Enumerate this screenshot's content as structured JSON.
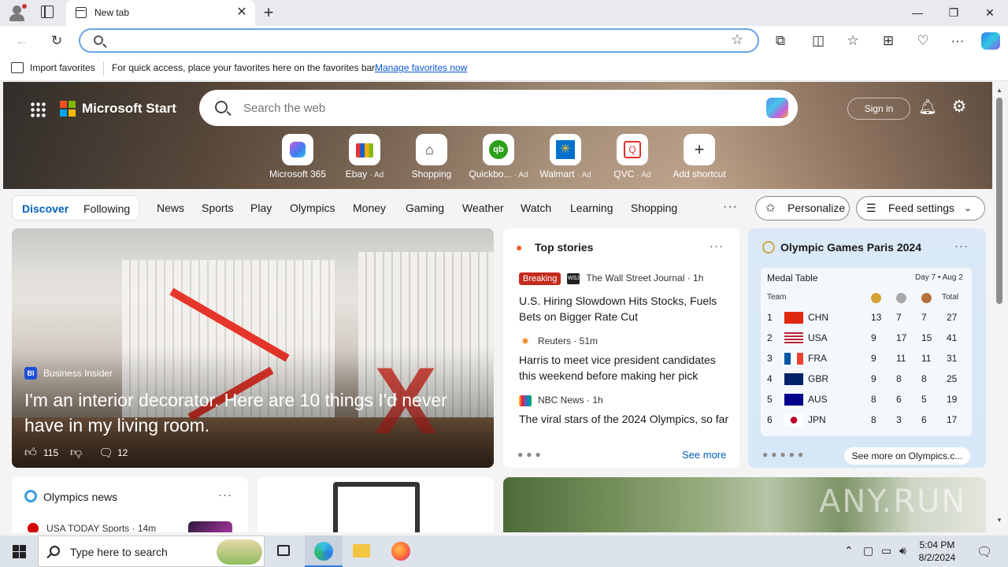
{
  "browser": {
    "tab_title": "New tab",
    "tab_close": "✕",
    "new_tab": "+",
    "address_placeholder": "",
    "window_controls": {
      "minimize": "—",
      "maximize": "❐",
      "close": "✕"
    },
    "toolbar_icons": [
      "back-icon",
      "refresh-icon",
      "star-icon",
      "extensions-icon",
      "split-screen-icon",
      "favorites-icon",
      "collections-icon",
      "performance-icon",
      "more-icon",
      "copilot-icon"
    ]
  },
  "favorites_bar": {
    "import_label": "Import favorites",
    "message": "For quick access, place your favorites here on the favorites bar.",
    "manage_link": "Manage favorites now"
  },
  "start_page": {
    "brand": "Microsoft Start",
    "search_placeholder": "Search the web",
    "sign_in": "Sign in",
    "shortcuts": [
      {
        "label": "Microsoft 365",
        "ad": "",
        "icon": "microsoft-365-icon"
      },
      {
        "label": "Ebay",
        "ad": "· Ad",
        "icon": "ebay-icon"
      },
      {
        "label": "Shopping",
        "ad": "",
        "icon": "shopping-tag-icon"
      },
      {
        "label": "Quickbo...",
        "ad": "· Ad",
        "icon": "quickbooks-icon"
      },
      {
        "label": "Walmart",
        "ad": "· Ad",
        "icon": "walmart-icon"
      },
      {
        "label": "QVC",
        "ad": "· Ad",
        "icon": "qvc-icon"
      },
      {
        "label": "Add shortcut",
        "ad": "",
        "icon": "plus-icon"
      }
    ],
    "nav": {
      "discover": "Discover",
      "following": "Following",
      "items": [
        "News",
        "Sports",
        "Play",
        "Olympics",
        "Money",
        "Gaming",
        "Weather",
        "Watch",
        "Learning",
        "Shopping"
      ],
      "more": "···",
      "personalize": "Personalize",
      "feed_settings": "Feed settings"
    },
    "hero": {
      "source": "Business Insider",
      "source_badge": "BI",
      "headline": "I'm an interior decorator. Here are 10 things I'd never have in my living room.",
      "likes": "115",
      "comments": "12"
    },
    "top_stories": {
      "title": "Top stories",
      "stories": [
        {
          "badge": "Breaking",
          "source": "The Wall Street Journal · 1h",
          "logo": "WSJ",
          "headline": "U.S. Hiring Slowdown Hits Stocks, Fuels Bets on Bigger Rate Cut"
        },
        {
          "badge": "",
          "source": "Reuters · 51m",
          "logo": "",
          "headline": "Harris to meet vice president candidates this weekend before making her pick"
        },
        {
          "badge": "",
          "source": "NBC News · 1h",
          "logo": "",
          "headline": "The viral stars of the 2024 Olympics, so far"
        }
      ],
      "see_more": "See more"
    },
    "olympics": {
      "title": "Olympic Games Paris 2024",
      "table_title": "Medal Table",
      "day": "Day 7 • Aug 2",
      "col_team": "Team",
      "col_total": "Total",
      "rows": [
        {
          "rank": "1",
          "team": "CHN",
          "gold": "13",
          "silver": "7",
          "bronze": "7",
          "total": "27"
        },
        {
          "rank": "2",
          "team": "USA",
          "gold": "9",
          "silver": "17",
          "bronze": "15",
          "total": "41"
        },
        {
          "rank": "3",
          "team": "FRA",
          "gold": "9",
          "silver": "11",
          "bronze": "11",
          "total": "31"
        },
        {
          "rank": "4",
          "team": "GBR",
          "gold": "9",
          "silver": "8",
          "bronze": "8",
          "total": "25"
        },
        {
          "rank": "5",
          "team": "AUS",
          "gold": "8",
          "silver": "6",
          "bronze": "5",
          "total": "19"
        },
        {
          "rank": "6",
          "team": "JPN",
          "gold": "8",
          "silver": "3",
          "bronze": "6",
          "total": "17"
        }
      ],
      "see_more": "See more on Olympics.c..."
    },
    "olympics_news": {
      "title": "Olympics news",
      "item_source": "USA TODAY Sports · 14m"
    },
    "watermark": "ANY.RUN"
  },
  "taskbar": {
    "search_placeholder": "Type here to search",
    "time": "5:04 PM",
    "date": "8/2/2024"
  },
  "colors": {
    "accent": "#0b57d0",
    "breaking": "#c42b1c",
    "address_focus": "#6aa5e8"
  }
}
